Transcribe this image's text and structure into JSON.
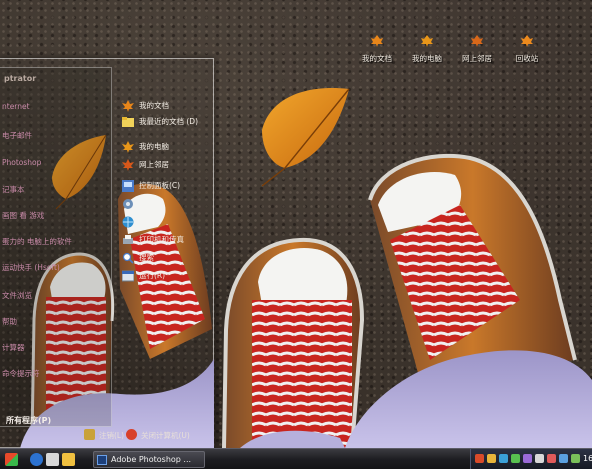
{
  "desktop": {
    "icons": [
      {
        "label": "我的文档",
        "icon": "leaf-icon"
      },
      {
        "label": "我的电脑",
        "icon": "leaf-icon"
      },
      {
        "label": "网上邻居",
        "icon": "leaf-icon"
      },
      {
        "label": "回收站",
        "icon": "leaf-icon"
      }
    ],
    "accent_colors": {
      "leaf": "#e08a1e",
      "shoe_red": "#c8251f",
      "lace": "#f2f2f2"
    }
  },
  "start_menu": {
    "user_header": "ptrator",
    "programs": [
      "nternet",
      "电子邮件",
      "Photoshop",
      "记事本",
      "画图 看 游戏",
      "蛋力的 电脑上的软件",
      "运动快手 (Hsoft)",
      "文件浏览",
      "帮助",
      "计算器",
      "命令提示符"
    ],
    "all_programs": "所有程序(P)",
    "right_items": [
      {
        "label": "我的文档",
        "icon": "folder-leaf-icon"
      },
      {
        "label": "我最近的文档 (D)",
        "icon": "recent-docs-icon"
      },
      {
        "label": "我的电脑",
        "icon": "computer-icon"
      },
      {
        "label": "网上邻居",
        "icon": "network-icon"
      },
      {
        "label": "控制面板(C)",
        "icon": "control-panel-icon"
      },
      {
        "label": "",
        "icon": "settings-icon"
      },
      {
        "label": "",
        "icon": "globe-icon"
      },
      {
        "label": "打印机和传真",
        "icon": "printer-icon"
      },
      {
        "label": "搜索",
        "icon": "search-icon"
      },
      {
        "label": "运行(R)",
        "icon": "run-icon"
      }
    ],
    "logoff_label": "注销(L)",
    "shutdown_label": "关闭计算机(U)"
  },
  "taskbar": {
    "task_label": "Adobe Photoshop ...",
    "clock": "16:",
    "tray_colors": [
      "#d84a2a",
      "#e8b43a",
      "#3aa0d8",
      "#58c050",
      "#9a6ad8",
      "#d8d8d8",
      "#e05a5a",
      "#5aa0e0",
      "#7ac05a"
    ]
  }
}
